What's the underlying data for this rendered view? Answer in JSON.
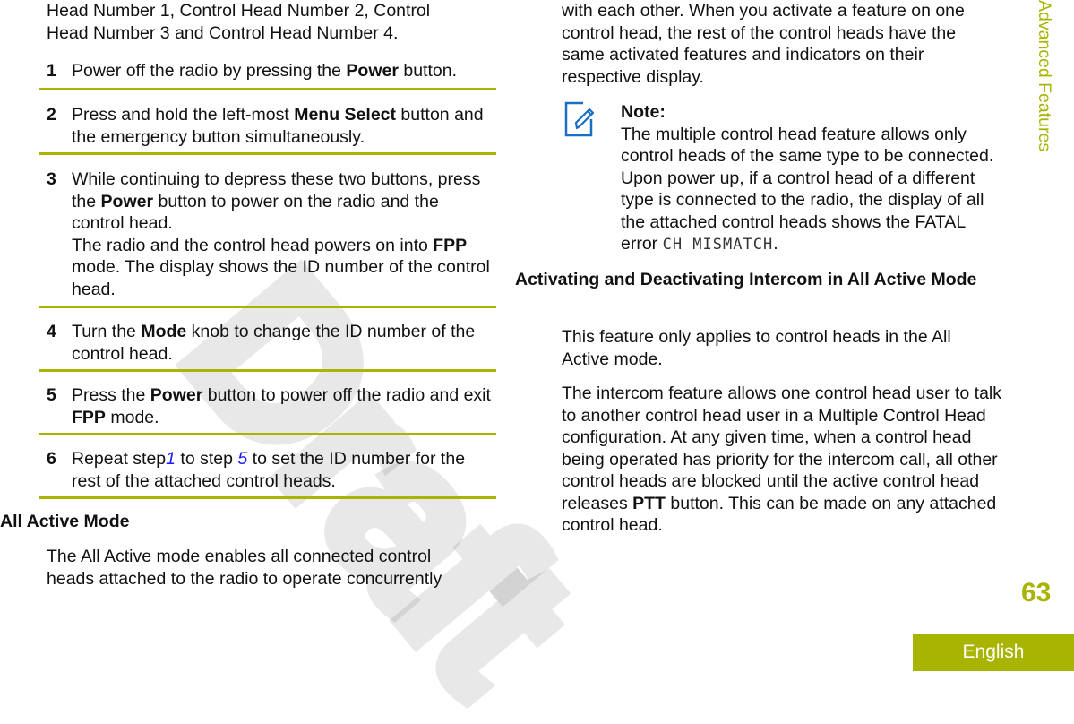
{
  "intro_text": [
    "Head Number 1, Control Head Number 2, Control",
    "Head Number 3 and Control Head Number 4."
  ],
  "steps": [
    {
      "num": "1",
      "pre": "Power off the radio by pressing the ",
      "bold": "Power",
      "post": " button."
    },
    {
      "num": "2",
      "pre": "Press and hold the left-most ",
      "bold": "Menu Select",
      "post": " button and the emergency button simultaneously."
    },
    {
      "num": "3",
      "pre": "While continuing to depress these two buttons, press the ",
      "bold": "Power",
      "post": " button to power on the radio and the control head.",
      "result_bold": "FPP",
      "result_pre": "The radio and the control head powers on into ",
      "result_post": " mode. The display shows the ID number of the control head."
    },
    {
      "num": "4",
      "pre": "Turn the ",
      "bold": "Mode",
      "post": " knob to change the ID number of the control head."
    },
    {
      "num": "5",
      "pre": "Press the ",
      "bold": "Power",
      "post": " button to power off the radio and exit ",
      "bold2": "FPP",
      "post2": " mode."
    },
    {
      "num": "6",
      "pre": "Repeat step",
      "link1": "1",
      "mid": " to step ",
      "link2": "5",
      "post": " to set the ID number for the rest of the attached control heads."
    }
  ],
  "all_active": {
    "heading": "All Active Mode",
    "body_left": "The All Active mode enables all connected control heads attached to the radio to operate concurrently",
    "body_right": "with each other. When you activate a feature on one control head, the rest of the control heads have the same activated features and indicators on their respective display."
  },
  "note": {
    "icon": "note-pencil-icon",
    "label": "Note:",
    "text": "The multiple control head feature allows only control heads of the same type to be connected. Upon power up, if a control head of a different type is connected to the radio, the display of all the attached control heads shows the FATAL error ",
    "code": "CH MISMATCH",
    "end": "."
  },
  "intercom": {
    "heading": "Activating and Deactivating Intercom in All Active Mode",
    "p1": "This feature only applies to control heads in the All Active mode.",
    "p2_pre": "The intercom feature allows one control head user to talk to another control head user in a Multiple Control Head configuration. At any given time, when a control head being operated has priority for the intercom call, all other control heads are blocked until the active control head releases ",
    "p2_bold": "PTT",
    "p2_post": " button. This can be made on any attached control head."
  },
  "side_label": "Advanced Features",
  "page_number": "63",
  "language": "English",
  "watermark": "Draft",
  "colors": {
    "accent": "#a8b400",
    "link": "#1a1aff",
    "icon": "#1a6fc4"
  }
}
